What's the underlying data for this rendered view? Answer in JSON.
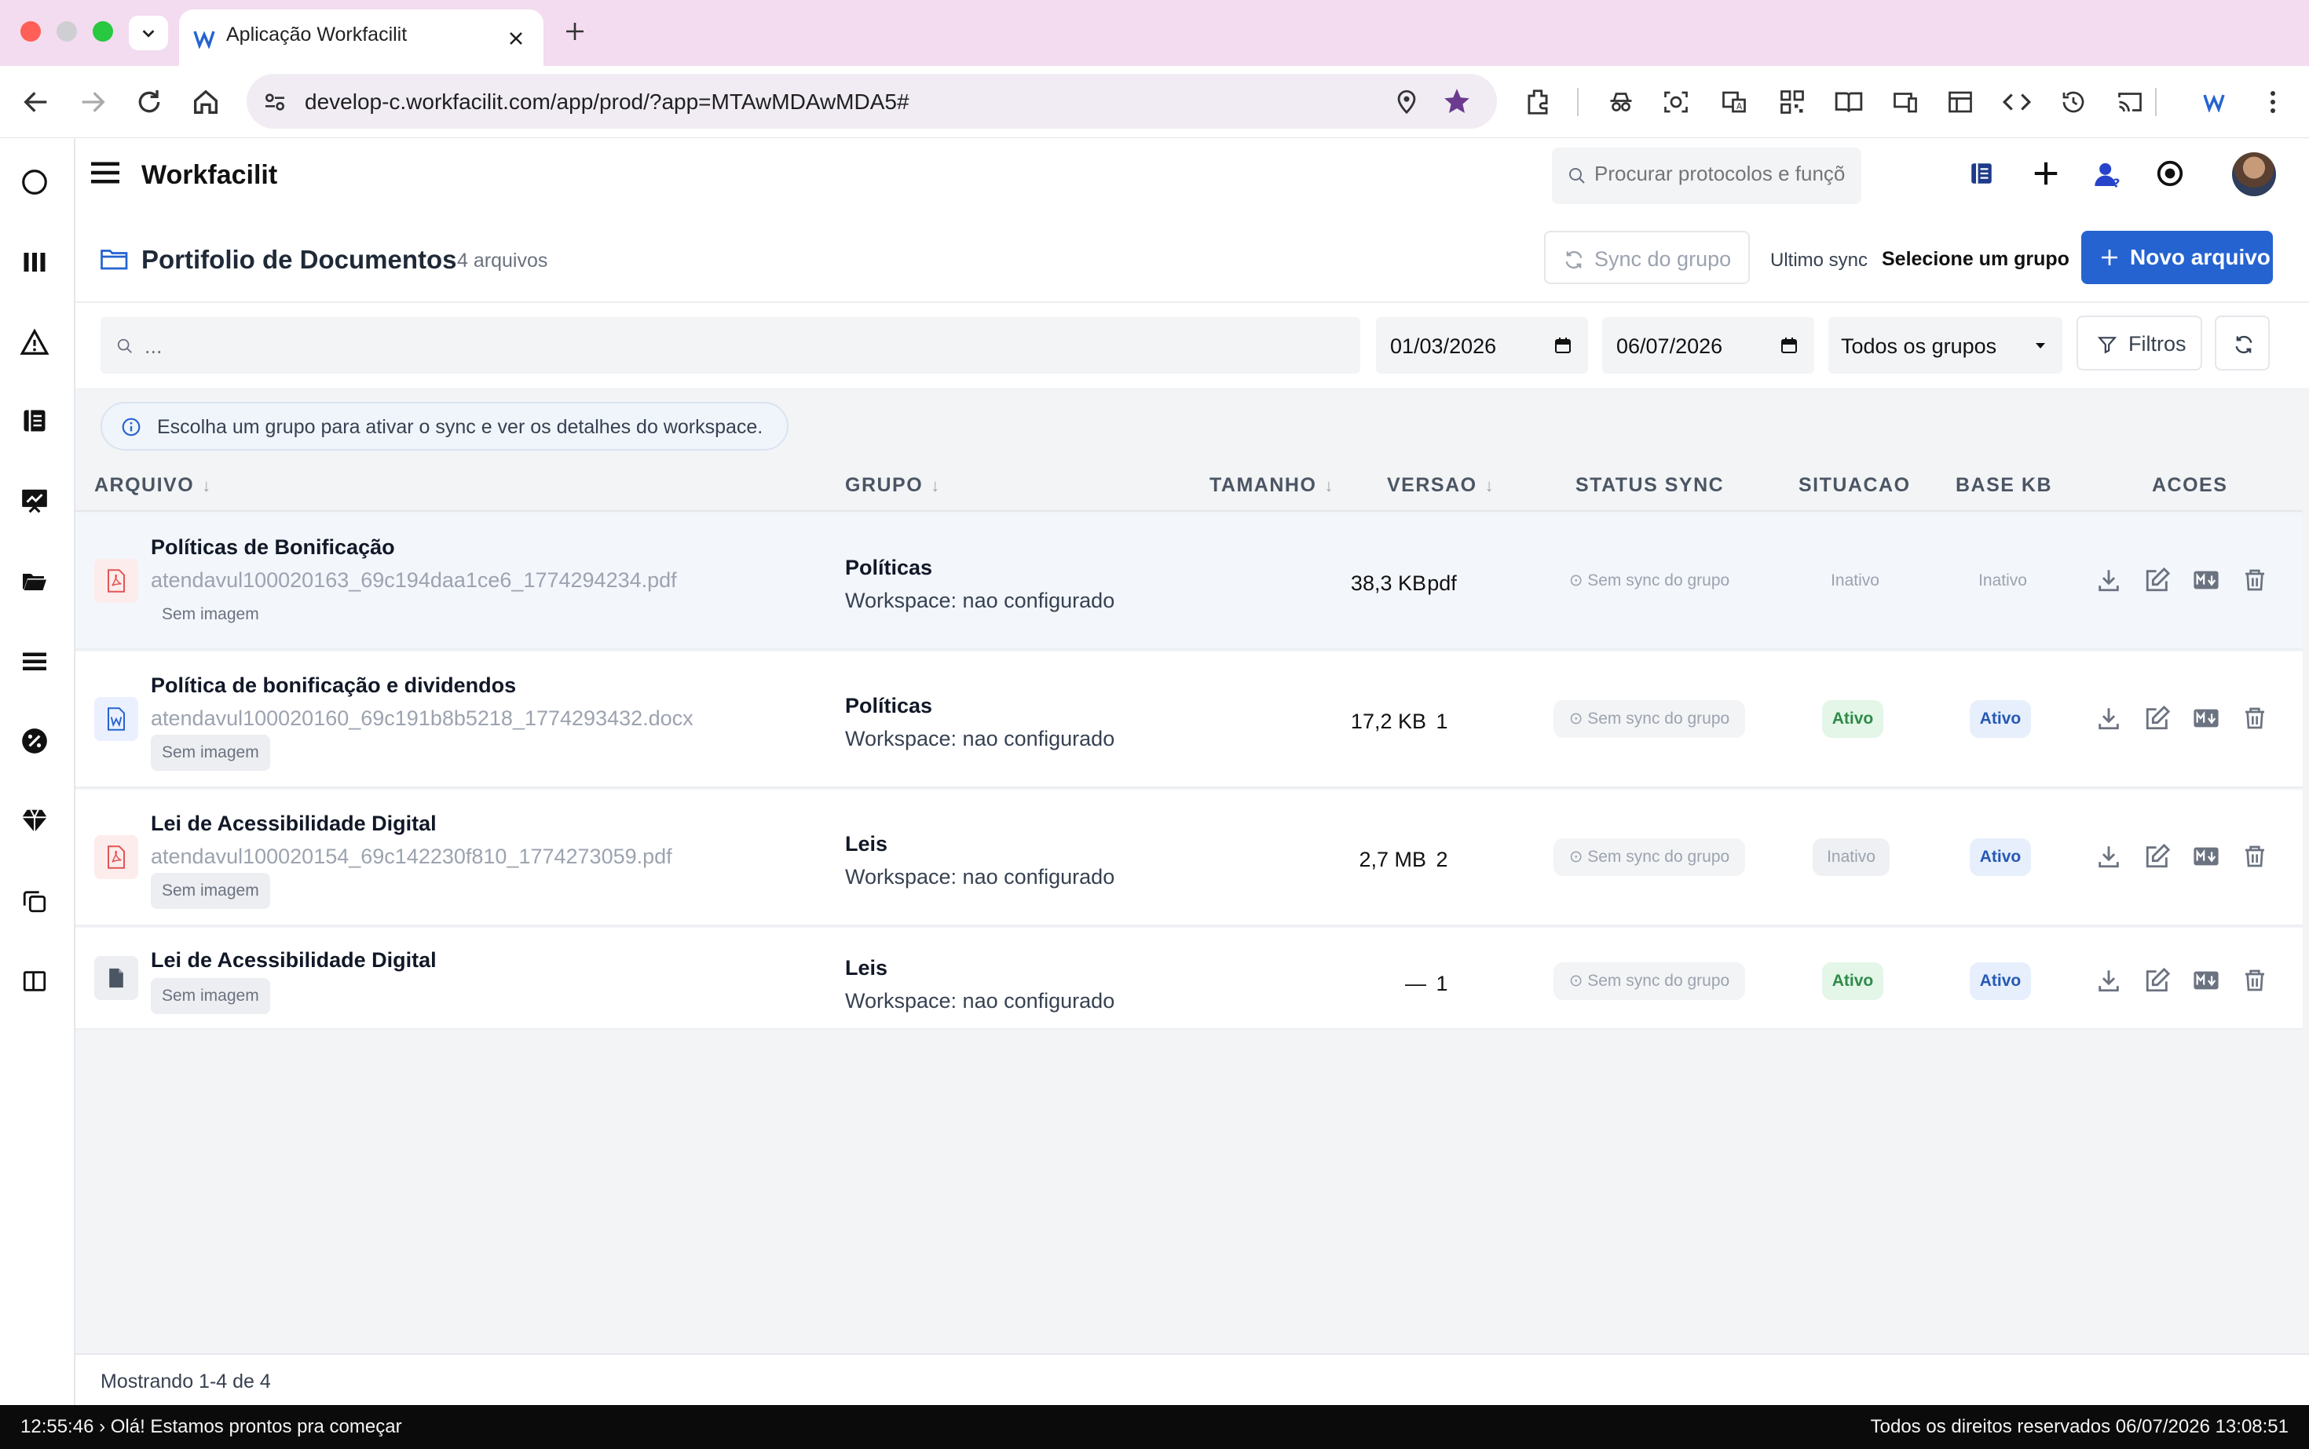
{
  "browser": {
    "tab_title": "Aplicação Workfacilit",
    "url": "develop-c.workfacilit.com/app/prod/?app=MTAwMDAwMDA5#"
  },
  "app": {
    "brand": "Workfacilit",
    "search_placeholder": "Procurar protocolos e funções"
  },
  "page": {
    "title": "Portifolio de Documentos",
    "count": "4 arquivos",
    "sync_button": "Sync do grupo",
    "last_sync_label": "Ultimo sync",
    "last_sync_value": "Selecione um grupo",
    "new_file_button": "Novo arquivo"
  },
  "filters": {
    "search_placeholder": "...",
    "date_from": "01/03/2026",
    "date_to": "06/07/2026",
    "group": "Todos os grupos",
    "filters_button": "Filtros"
  },
  "notice": "Escolha um grupo para ativar o sync e ver os detalhes do workspace.",
  "table": {
    "headers": {
      "arquivo": "ARQUIVO",
      "grupo": "GRUPO",
      "tamanho": "TAMANHO",
      "versao": "VERSAO",
      "status_sync": "STATUS SYNC",
      "situacao": "SITUACAO",
      "base_kb": "BASE KB",
      "acoes": "ACOES"
    },
    "rows": [
      {
        "name": "Políticas de Bonificação",
        "path": "atendavul100020163_69c194daa1ce6_1774294234.pdf",
        "image": "Sem imagem",
        "group": "Políticas",
        "workspace": "Workspace: nao configurado",
        "size": "38,3 KB",
        "version": "pdf",
        "sync": "Sem sync do grupo",
        "situacao": "Inativo",
        "base_kb": "Inativo"
      },
      {
        "name": "Política de bonificação e dividendos",
        "path": "atendavul100020160_69c191b8b5218_1774293432.docx",
        "image": "Sem imagem",
        "group": "Políticas",
        "workspace": "Workspace: nao configurado",
        "size": "17,2 KB",
        "version": "1",
        "sync": "Sem sync do grupo",
        "situacao": "Ativo",
        "base_kb": "Ativo"
      },
      {
        "name": "Lei de Acessibilidade Digital",
        "path": "atendavul100020154_69c142230f810_1774273059.pdf",
        "image": "Sem imagem",
        "group": "Leis",
        "workspace": "Workspace: nao configurado",
        "size": "2,7 MB",
        "version": "2",
        "sync": "Sem sync do grupo",
        "situacao": "Inativo",
        "base_kb": "Ativo"
      },
      {
        "name": "Lei de Acessibilidade Digital",
        "image": "Sem imagem",
        "group": "Leis",
        "workspace": "Workspace: nao configurado",
        "size": "—",
        "version": "1",
        "sync": "Sem sync do grupo",
        "situacao": "Ativo",
        "base_kb": "Ativo"
      }
    ]
  },
  "footer": "Mostrando 1-4 de 4",
  "statusbar": {
    "left": "12:55:46 › Olá! Estamos prontos pra começar",
    "right": "Todos os direitos reservados 06/07/2026 13:08:51"
  },
  "colors": {
    "primary": "#2563d1",
    "ativo_green": "#2f8a48",
    "ativo_blue": "#2559b5",
    "tabbar": "#f3dcef"
  }
}
